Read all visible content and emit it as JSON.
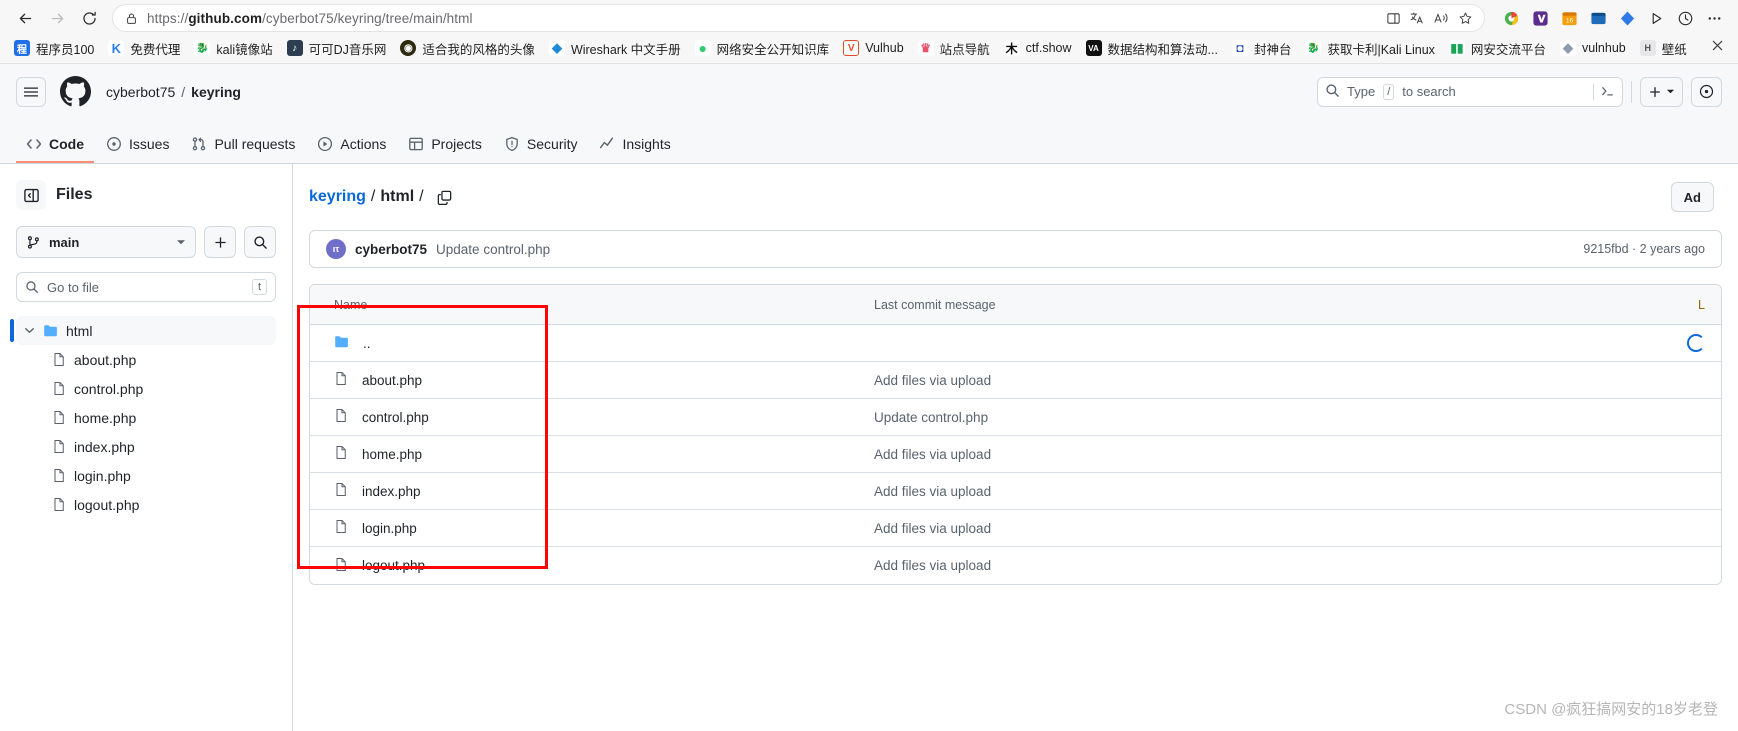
{
  "browser": {
    "url": {
      "scheme": "https://",
      "host": "github.com",
      "path": "/cyberbot75/keyring/tree/main/html",
      "full": "https://github.com/cyberbot75/keyring/tree/main/html"
    },
    "nav": {
      "back": "back-arrow",
      "forward": "forward-arrow",
      "reload": "reload"
    },
    "bookmarks": [
      {
        "label": "程序员100",
        "color": "#1f6feb",
        "glyph": "程"
      },
      {
        "label": "免费代理",
        "color": "#2f80ed",
        "glyph": "K"
      },
      {
        "label": "kali镜像站",
        "color": "#111111",
        "glyph": "K"
      },
      {
        "label": "可可DJ音乐网",
        "color": "#2c3e50",
        "glyph": "♪"
      },
      {
        "label": "适合我的风格的头像",
        "color": "#2b2b10",
        "glyph": "◉"
      },
      {
        "label": "Wireshark 中文手册",
        "color": "#1f8ad6",
        "glyph": "W"
      },
      {
        "label": "网络安全公开知识库",
        "color": "#2ecc71",
        "glyph": "●"
      },
      {
        "label": "Vulhub",
        "color": "#e34c26",
        "glyph": "V"
      },
      {
        "label": "站点导航",
        "color": "#e8536b",
        "glyph": "站"
      },
      {
        "label": "ctf.show",
        "color": "#222222",
        "glyph": "木"
      },
      {
        "label": "数据结构和算法动...",
        "color": "#111111",
        "glyph": "VA"
      },
      {
        "label": "封神台",
        "color": "#2b4fb5",
        "glyph": "封"
      },
      {
        "label": "获取卡利|Kali Linux",
        "color": "#111111",
        "glyph": "K"
      },
      {
        "label": "网安交流平台",
        "color": "#18a558",
        "glyph": "▮"
      },
      {
        "label": "vulnhub",
        "color": "#8e9aaf",
        "glyph": "◆"
      },
      {
        "label": "壁纸",
        "color": "#6b7280",
        "glyph": "H"
      }
    ],
    "bookmark_overflow_close": "×"
  },
  "github": {
    "header": {
      "owner": "cyberbot75",
      "separator": "/",
      "repo": "keyring",
      "search_placeholder": "Type  /  to search",
      "search_prefix": "Type",
      "search_kbd": "/",
      "search_suffix": "to search",
      "create_new_label": "+",
      "issues_badge": ""
    },
    "tabs": [
      {
        "label": "Code",
        "icon": "code-icon",
        "active": true
      },
      {
        "label": "Issues",
        "icon": "issue-opened-icon",
        "active": false
      },
      {
        "label": "Pull requests",
        "icon": "git-pull-request-icon",
        "active": false
      },
      {
        "label": "Actions",
        "icon": "play-icon",
        "active": false
      },
      {
        "label": "Projects",
        "icon": "table-icon",
        "active": false
      },
      {
        "label": "Security",
        "icon": "shield-icon",
        "active": false
      },
      {
        "label": "Insights",
        "icon": "graph-icon",
        "active": false
      }
    ],
    "sidebar": {
      "title": "Files",
      "branch": "main",
      "add_label": "+",
      "search_label": "search",
      "go_to_file_placeholder": "Go to file",
      "go_to_file_kbd": "t",
      "tree": [
        {
          "label": "html",
          "type": "folder",
          "expanded": true,
          "selected": true
        },
        {
          "label": "about.php",
          "type": "file"
        },
        {
          "label": "control.php",
          "type": "file"
        },
        {
          "label": "home.php",
          "type": "file"
        },
        {
          "label": "index.php",
          "type": "file"
        },
        {
          "label": "login.php",
          "type": "file"
        },
        {
          "label": "logout.php",
          "type": "file"
        }
      ]
    },
    "main": {
      "breadcrumb": {
        "repo": "keyring",
        "slash1": "/",
        "folder": "html",
        "slash2": "/"
      },
      "copy_path_icon": "copy-icon",
      "add_file_button": "Ad",
      "commit": {
        "author": "cyberbot75",
        "avatar_initials": "ιτ",
        "message": "Update control.php",
        "meta": "9215fbd · 2 years ago"
      },
      "table": {
        "columns": [
          "Name",
          "Last commit message",
          "L"
        ],
        "rows": [
          {
            "name": "..",
            "icon": "folder-icon",
            "message": "",
            "time": ""
          },
          {
            "name": "about.php",
            "icon": "file-icon",
            "message": "Add files via upload",
            "time": ""
          },
          {
            "name": "control.php",
            "icon": "file-icon",
            "message": "Update control.php",
            "time": ""
          },
          {
            "name": "home.php",
            "icon": "file-icon",
            "message": "Add files via upload",
            "time": ""
          },
          {
            "name": "index.php",
            "icon": "file-icon",
            "message": "Add files via upload",
            "time": ""
          },
          {
            "name": "login.php",
            "icon": "file-icon",
            "message": "Add files via upload",
            "time": ""
          },
          {
            "name": "logout.php",
            "icon": "file-icon",
            "message": "Add files via upload",
            "time": ""
          }
        ]
      }
    }
  },
  "annotation": {
    "color": "#fb0505"
  },
  "watermark": "CSDN @疯狂搞网安的18岁老登"
}
